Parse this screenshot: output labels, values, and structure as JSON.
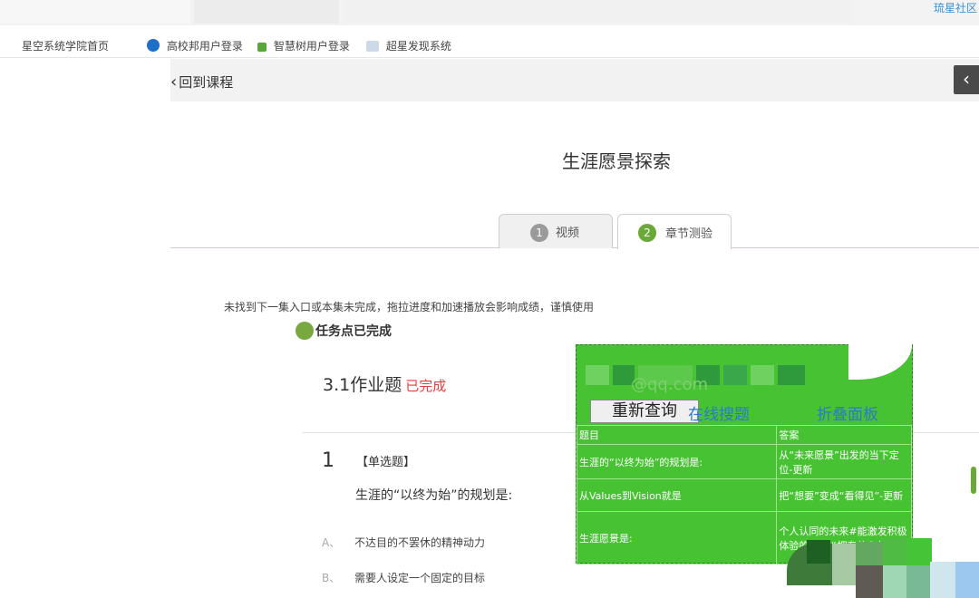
{
  "browser": {
    "corner_link": "琉星社区",
    "bookmarks": [
      {
        "label": "星空系统学院首页",
        "icon_color": "#3a7bd5"
      },
      {
        "label": "高校邦用户登录",
        "icon_color": "#1f6fc9"
      },
      {
        "label": "智慧树用户登录",
        "icon_color": "#5aa53b"
      },
      {
        "label": "超星发现系统",
        "icon_color": "#cfd8e6"
      }
    ]
  },
  "nav": {
    "back_label": "回到课程",
    "back_icon": "chevron-left-icon",
    "side_toggle_icon": "chevron-left-icon"
  },
  "course": {
    "title": "生涯愿景探索",
    "tabs": [
      {
        "num": "1",
        "label": "视频"
      },
      {
        "num": "2",
        "label": "章节测验"
      }
    ]
  },
  "content": {
    "notice": "未找到下一集入口或本集未完成，拖拉进度和加速播放会影响成绩，谨慎使用",
    "task_status": "任务点已完成",
    "homework_title": "3.1作业题",
    "homework_status": "已完成",
    "question": {
      "number": "1",
      "type": "【单选题】",
      "text": "生涯的“以终为始”的规划是:",
      "options": [
        {
          "letter": "A、",
          "text": "不达目的不罢休的精神动力"
        },
        {
          "letter": "B、",
          "text": "需要人设定一个固定的目标"
        }
      ]
    }
  },
  "overlay": {
    "email_fragment": "@qq.com",
    "requery_button": "重新查询",
    "search_online_link": "在线搜题",
    "fold_panel_link": "折叠面板",
    "table": {
      "headers": [
        "题目",
        "答案"
      ],
      "rows": [
        {
          "question": "生涯的“以终为始”的规划是:",
          "answer": "从“未来愿景”出发的当下定位-更新"
        },
        {
          "question": "从Values到Vision就是",
          "answer": "把“想要”变成“看得见”-更新"
        },
        {
          "question": "生涯愿景是:",
          "answer": "个人认同的未来#能激发积极体验的想像#拥有信心的"
        }
      ]
    },
    "colors": {
      "panel": "#47c233",
      "links": "#2b78d0"
    }
  }
}
